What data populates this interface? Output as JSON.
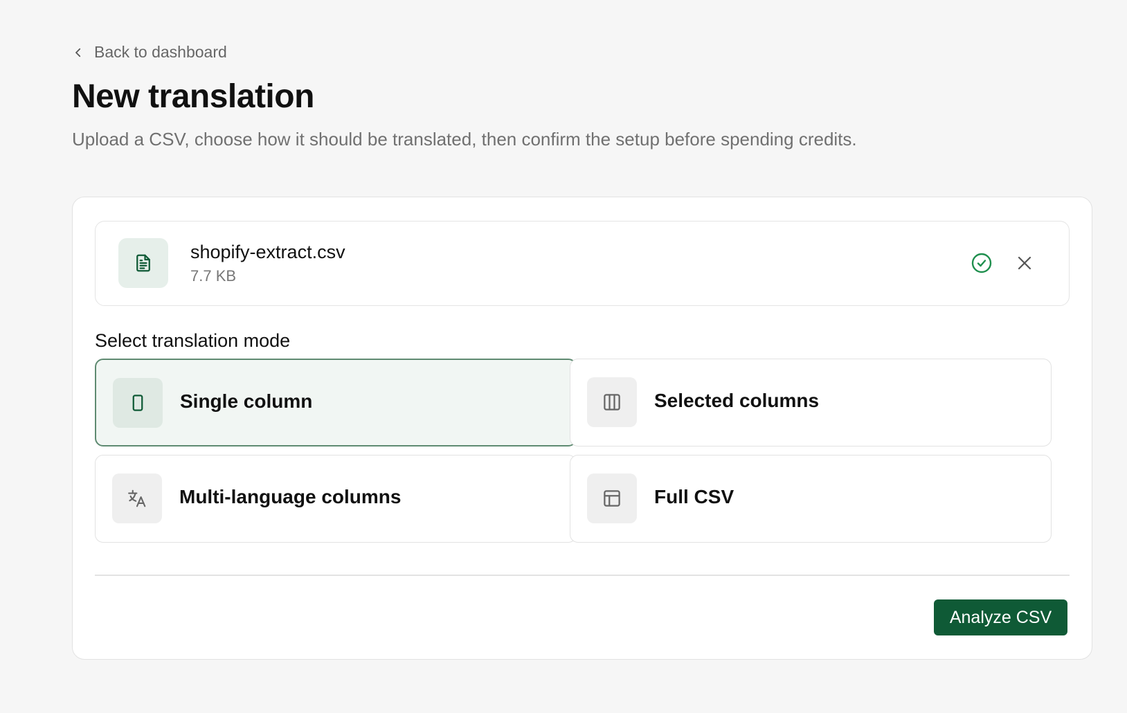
{
  "nav": {
    "back_label": "Back to dashboard"
  },
  "header": {
    "title": "New translation",
    "subtitle": "Upload a CSV, choose how it should be translated, then confirm the setup before spending credits."
  },
  "file": {
    "name": "shopify-extract.csv",
    "size": "7.7 KB",
    "status": "uploaded",
    "icon": "file-text-icon"
  },
  "modes": {
    "label": "Select translation mode",
    "selected": "single",
    "options": [
      {
        "id": "single",
        "label": "Single column",
        "icon": "single-column-icon"
      },
      {
        "id": "selected",
        "label": "Selected columns",
        "icon": "columns-icon"
      },
      {
        "id": "multi",
        "label": "Multi-language columns",
        "icon": "translate-icon"
      },
      {
        "id": "full",
        "label": "Full CSV",
        "icon": "table-icon"
      }
    ]
  },
  "actions": {
    "analyze_label": "Analyze CSV"
  },
  "colors": {
    "accent": "#0f5a36",
    "selected_border": "#5e8a71",
    "selected_bg": "#f1f6f3",
    "success": "#1f8f4e"
  }
}
